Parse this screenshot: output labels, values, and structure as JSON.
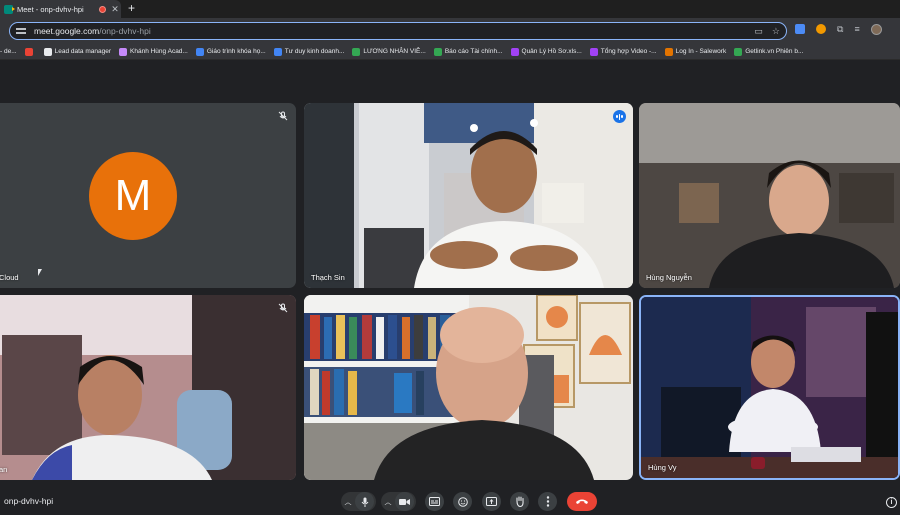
{
  "browser": {
    "tab": {
      "title": "Meet - onp-dvhv-hpi",
      "close": "✕"
    },
    "new_tab": "+",
    "url_host": "meet.google.com",
    "url_path": "/onp-dvhv-hpi"
  },
  "bookmarks": [
    {
      "label": "- de...",
      "color": "#9aa0a6"
    },
    {
      "label": "",
      "color": "#ea4335"
    },
    {
      "label": "Lead data manager",
      "color": "#e8eaed"
    },
    {
      "label": "Khánh Hùng Acad...",
      "color": "#c58af9"
    },
    {
      "label": "Giáo trình khóa họ...",
      "color": "#4285f4"
    },
    {
      "label": "Tư duy kinh doanh...",
      "color": "#4285f4"
    },
    {
      "label": "LƯƠNG NHÂN VIÊ...",
      "color": "#34a853"
    },
    {
      "label": "Báo cáo Tài chính...",
      "color": "#34a853"
    },
    {
      "label": "Quản Lý Hồ Sơ.xls...",
      "color": "#a142f4"
    },
    {
      "label": "Tổng hợp Video -...",
      "color": "#a142f4"
    },
    {
      "label": "Log In - Salework",
      "color": "#e37400"
    },
    {
      "label": "Getlink.vn Phiên b...",
      "color": "#34a853"
    }
  ],
  "participants": [
    {
      "name": "Cloud",
      "initial": "M",
      "muted": true
    },
    {
      "name": "Thạch Sin",
      "speaking": true
    },
    {
      "name": "Hùng Nguyễn"
    },
    {
      "name": "an",
      "muted": true
    },
    {
      "name": ""
    },
    {
      "name": "Hùng Vy",
      "active": true
    }
  ],
  "controls": {
    "meeting_code": "onp-dvhv-hpi",
    "info": "i"
  }
}
